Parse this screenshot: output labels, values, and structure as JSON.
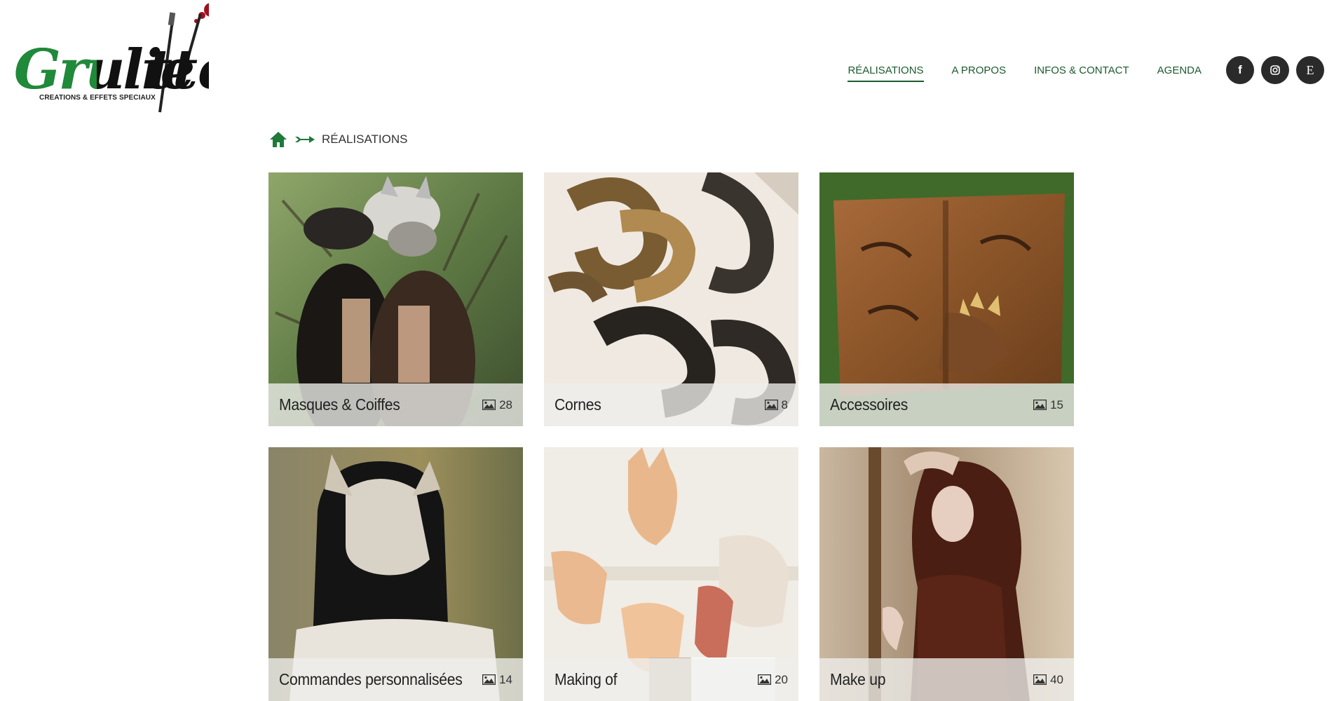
{
  "brand": {
    "name": "Gruliette",
    "tagline": "CREATIONS & EFFETS SPECIAUX"
  },
  "nav": {
    "items": [
      {
        "label": "RÉALISATIONS",
        "active": true
      },
      {
        "label": "A PROPOS",
        "active": false
      },
      {
        "label": "INFOS & CONTACT",
        "active": false
      },
      {
        "label": "AGENDA",
        "active": false
      }
    ],
    "social": [
      {
        "icon": "facebook-icon",
        "glyph": "f"
      },
      {
        "icon": "instagram-icon",
        "glyph": ""
      },
      {
        "icon": "etsy-icon",
        "glyph": "E"
      }
    ]
  },
  "breadcrumb": {
    "current": "RÉALISATIONS"
  },
  "gallery": [
    {
      "title": "Masques & Coiffes",
      "count": "28"
    },
    {
      "title": "Cornes",
      "count": "8"
    },
    {
      "title": "Accessoires",
      "count": "15"
    },
    {
      "title": "Commandes personnalisées",
      "count": "14"
    },
    {
      "title": "Making of",
      "count": "20"
    },
    {
      "title": "Make up",
      "count": "40"
    }
  ],
  "colors": {
    "accent": "#1d5a2e",
    "social_bg": "#2a2a2a",
    "logo_green": "#1f8a3a",
    "logo_red": "#a01020"
  }
}
